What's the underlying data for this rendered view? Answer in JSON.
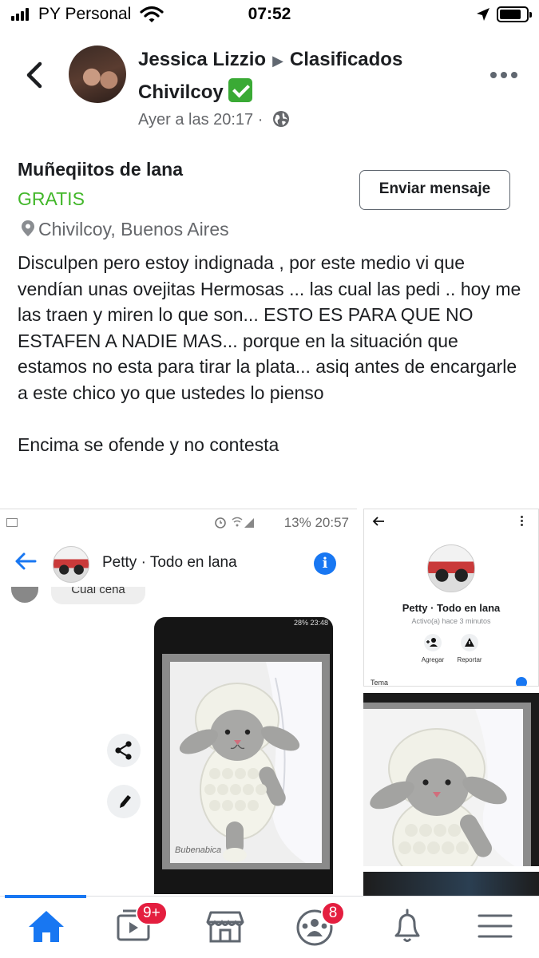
{
  "status_bar": {
    "carrier": "PY Personal",
    "time": "07:52",
    "signal_icon": "signal-bars-icon",
    "wifi_icon": "wifi-icon",
    "location_icon": "location-arrow-icon",
    "battery_icon": "battery-icon"
  },
  "post": {
    "author": "Jessica Lizzio",
    "group_line1": "Clasificados",
    "group_line2": "Chivilcoy",
    "timestamp": "Ayer a las 20:17",
    "meta_separator": "·",
    "verified_icon": "green-check-icon",
    "privacy_icon": "globe-icon"
  },
  "listing": {
    "title": "Muñeqiitos de lana",
    "price": "GRATIS",
    "location": "Chivilcoy, Buenos Aires",
    "message_button": "Enviar mensaje",
    "price_color": "#42b72a"
  },
  "body": {
    "text": "Disculpen pero estoy indignada , por este medio vi que vendían unas ovejitas Hermosas ... las cual las pedi .. hoy me las traen y miren lo que son... ESTO ES PARA QUE NO ESTAFEN A NADIE MAS... porque en la situación que estamos no esta para tirar la plata... asiq antes de encargarle a este chico yo que ustedes lo pienso\n\nEncima se ofende y no contesta"
  },
  "screenshot_main": {
    "status_text": "13% 20:57",
    "chat_name": "Petty · Todo en lana",
    "bubble_text": "Cual cena",
    "inner_status": "28% 23:48",
    "watermark": "Bubenabica"
  },
  "screenshot_profile": {
    "name": "Petty · Todo en lana",
    "active": "Activo(a) hace 3 minutos",
    "action_add": "Agregar",
    "action_report": "Reportar",
    "theme_label": "Tema"
  },
  "nav": {
    "watch_badge": "9+",
    "groups_badge": "8",
    "accent_color": "#1877f2",
    "badge_color": "#e41e3f"
  }
}
